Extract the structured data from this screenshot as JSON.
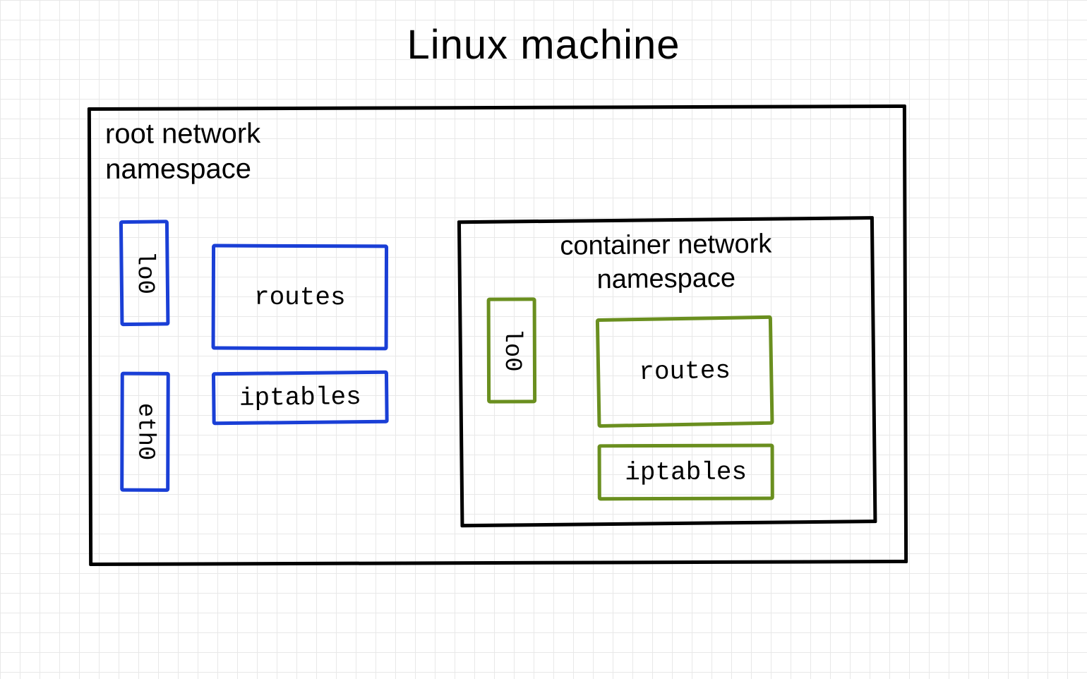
{
  "title": "Linux machine",
  "root_ns": {
    "label_line1": "root network",
    "label_line2": "namespace",
    "interfaces": {
      "lo0": "lo0",
      "eth0": "eth0"
    },
    "boxes": {
      "routes": "routes",
      "iptables": "iptables"
    }
  },
  "container_ns": {
    "label_line1": "container network",
    "label_line2": "namespace",
    "interfaces": {
      "lo0": "lo0"
    },
    "boxes": {
      "routes": "routes",
      "iptables": "iptables"
    }
  },
  "colors": {
    "root": "#1a3fd6",
    "container": "#6a8f1f",
    "outline": "#000000"
  }
}
